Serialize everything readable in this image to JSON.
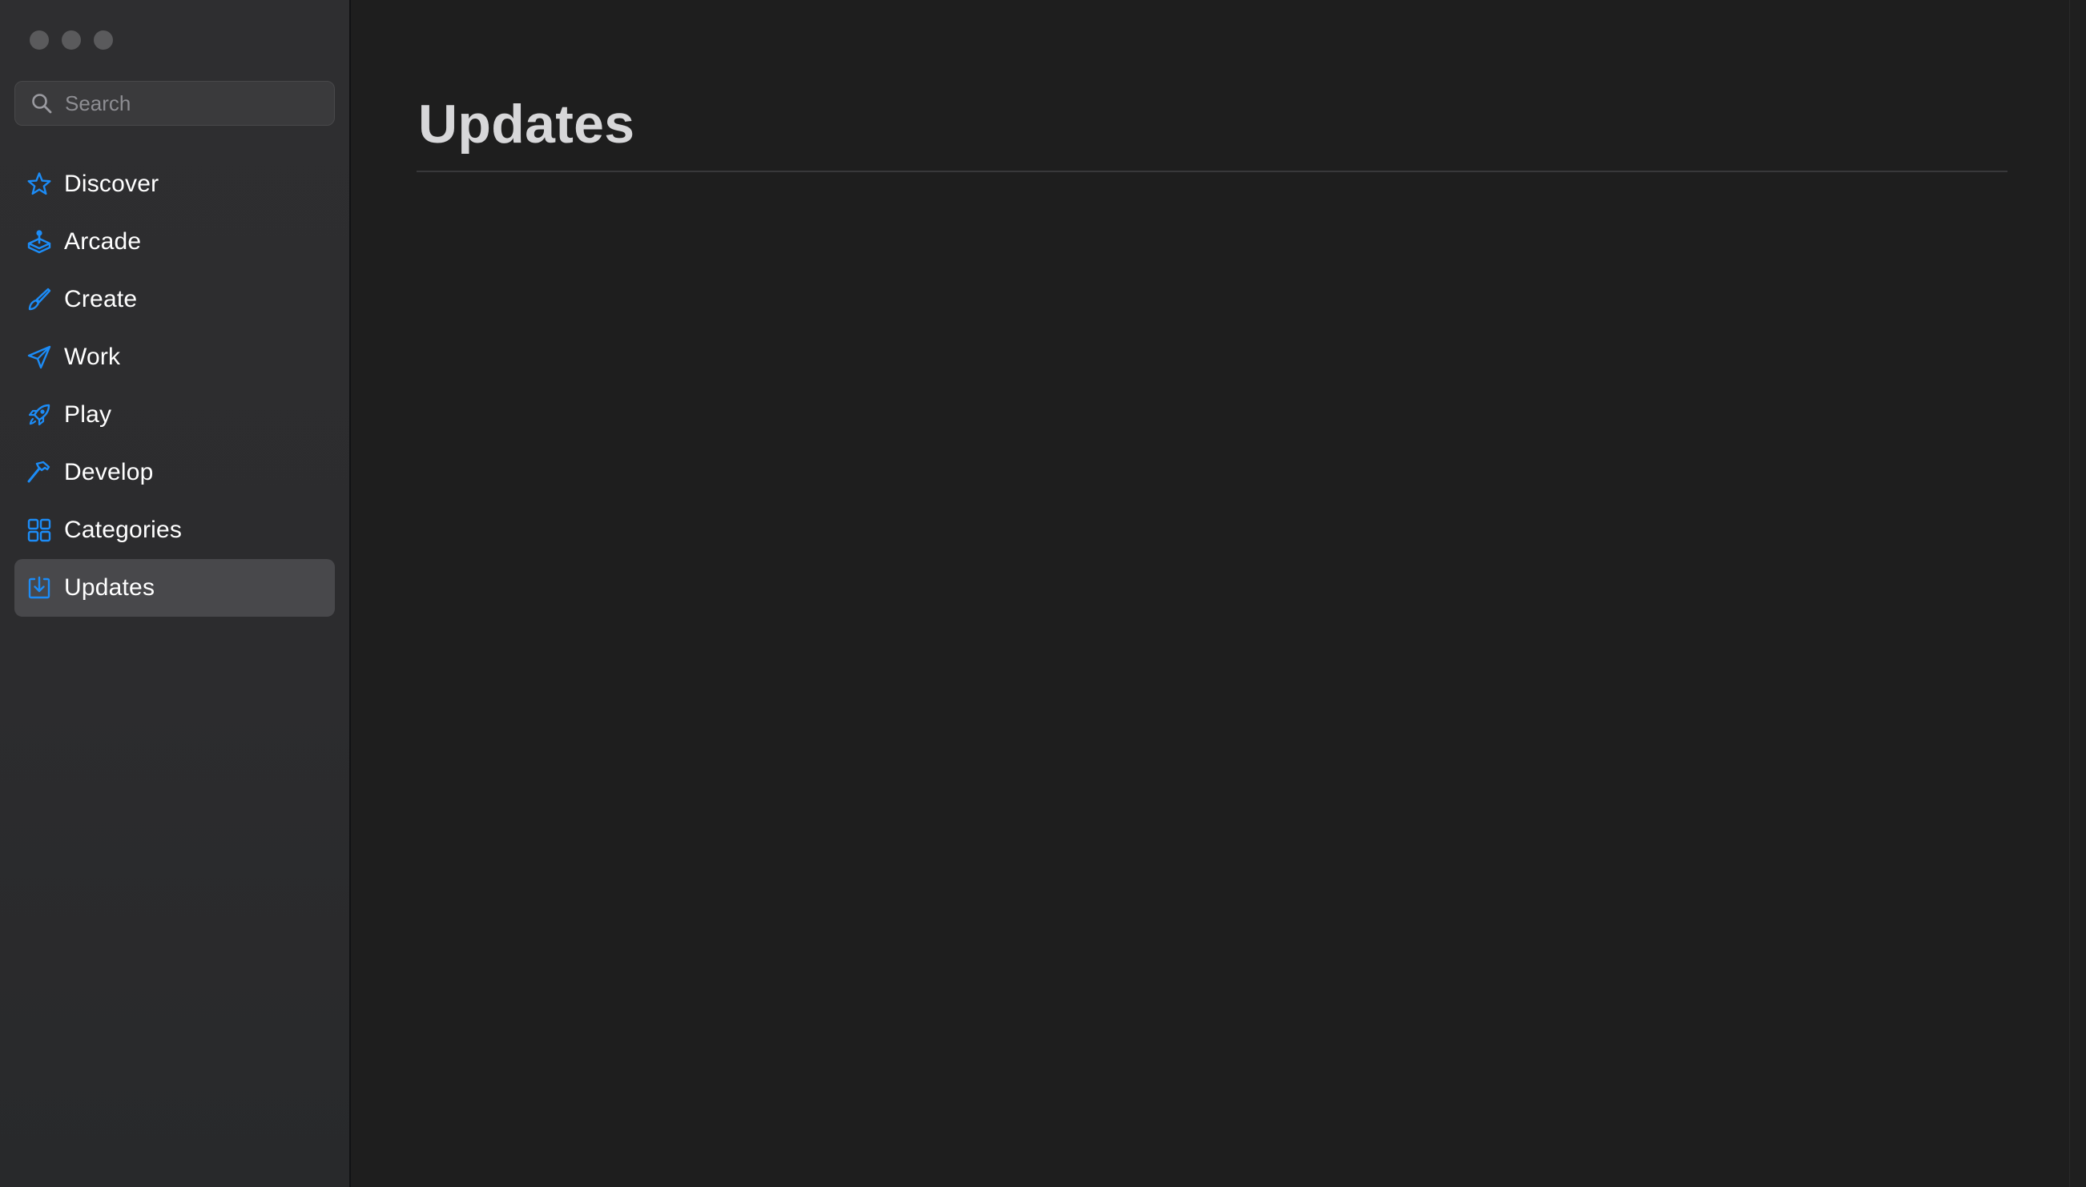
{
  "window": {
    "traffic_lights": [
      "close",
      "minimize",
      "zoom"
    ]
  },
  "search": {
    "placeholder": "Search",
    "value": ""
  },
  "sidebar": {
    "items": [
      {
        "label": "Discover",
        "icon": "star-icon",
        "selected": false
      },
      {
        "label": "Arcade",
        "icon": "joystick-icon",
        "selected": false
      },
      {
        "label": "Create",
        "icon": "paintbrush-icon",
        "selected": false
      },
      {
        "label": "Work",
        "icon": "paperplane-icon",
        "selected": false
      },
      {
        "label": "Play",
        "icon": "rocket-icon",
        "selected": false
      },
      {
        "label": "Develop",
        "icon": "hammer-icon",
        "selected": false
      },
      {
        "label": "Categories",
        "icon": "grid-icon",
        "selected": false
      },
      {
        "label": "Updates",
        "icon": "download-icon",
        "selected": true
      }
    ]
  },
  "main": {
    "title": "Updates"
  },
  "colors": {
    "accent": "#1c8cf7",
    "sidebar_bg": "#2d2d2f",
    "main_bg": "#1e1e1e",
    "selected_bg": "#48484b",
    "traffic_light": "#5a5a5c"
  }
}
